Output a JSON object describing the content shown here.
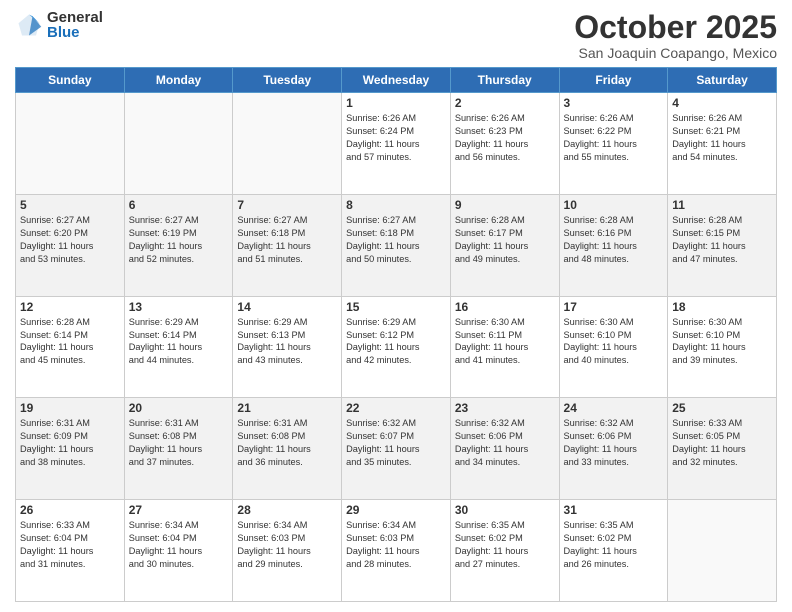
{
  "header": {
    "logo_general": "General",
    "logo_blue": "Blue",
    "month_title": "October 2025",
    "location": "San Joaquin Coapango, Mexico"
  },
  "days_of_week": [
    "Sunday",
    "Monday",
    "Tuesday",
    "Wednesday",
    "Thursday",
    "Friday",
    "Saturday"
  ],
  "weeks": [
    [
      {
        "day": "",
        "info": ""
      },
      {
        "day": "",
        "info": ""
      },
      {
        "day": "",
        "info": ""
      },
      {
        "day": "1",
        "info": "Sunrise: 6:26 AM\nSunset: 6:24 PM\nDaylight: 11 hours\nand 57 minutes."
      },
      {
        "day": "2",
        "info": "Sunrise: 6:26 AM\nSunset: 6:23 PM\nDaylight: 11 hours\nand 56 minutes."
      },
      {
        "day": "3",
        "info": "Sunrise: 6:26 AM\nSunset: 6:22 PM\nDaylight: 11 hours\nand 55 minutes."
      },
      {
        "day": "4",
        "info": "Sunrise: 6:26 AM\nSunset: 6:21 PM\nDaylight: 11 hours\nand 54 minutes."
      }
    ],
    [
      {
        "day": "5",
        "info": "Sunrise: 6:27 AM\nSunset: 6:20 PM\nDaylight: 11 hours\nand 53 minutes."
      },
      {
        "day": "6",
        "info": "Sunrise: 6:27 AM\nSunset: 6:19 PM\nDaylight: 11 hours\nand 52 minutes."
      },
      {
        "day": "7",
        "info": "Sunrise: 6:27 AM\nSunset: 6:18 PM\nDaylight: 11 hours\nand 51 minutes."
      },
      {
        "day": "8",
        "info": "Sunrise: 6:27 AM\nSunset: 6:18 PM\nDaylight: 11 hours\nand 50 minutes."
      },
      {
        "day": "9",
        "info": "Sunrise: 6:28 AM\nSunset: 6:17 PM\nDaylight: 11 hours\nand 49 minutes."
      },
      {
        "day": "10",
        "info": "Sunrise: 6:28 AM\nSunset: 6:16 PM\nDaylight: 11 hours\nand 48 minutes."
      },
      {
        "day": "11",
        "info": "Sunrise: 6:28 AM\nSunset: 6:15 PM\nDaylight: 11 hours\nand 47 minutes."
      }
    ],
    [
      {
        "day": "12",
        "info": "Sunrise: 6:28 AM\nSunset: 6:14 PM\nDaylight: 11 hours\nand 45 minutes."
      },
      {
        "day": "13",
        "info": "Sunrise: 6:29 AM\nSunset: 6:14 PM\nDaylight: 11 hours\nand 44 minutes."
      },
      {
        "day": "14",
        "info": "Sunrise: 6:29 AM\nSunset: 6:13 PM\nDaylight: 11 hours\nand 43 minutes."
      },
      {
        "day": "15",
        "info": "Sunrise: 6:29 AM\nSunset: 6:12 PM\nDaylight: 11 hours\nand 42 minutes."
      },
      {
        "day": "16",
        "info": "Sunrise: 6:30 AM\nSunset: 6:11 PM\nDaylight: 11 hours\nand 41 minutes."
      },
      {
        "day": "17",
        "info": "Sunrise: 6:30 AM\nSunset: 6:10 PM\nDaylight: 11 hours\nand 40 minutes."
      },
      {
        "day": "18",
        "info": "Sunrise: 6:30 AM\nSunset: 6:10 PM\nDaylight: 11 hours\nand 39 minutes."
      }
    ],
    [
      {
        "day": "19",
        "info": "Sunrise: 6:31 AM\nSunset: 6:09 PM\nDaylight: 11 hours\nand 38 minutes."
      },
      {
        "day": "20",
        "info": "Sunrise: 6:31 AM\nSunset: 6:08 PM\nDaylight: 11 hours\nand 37 minutes."
      },
      {
        "day": "21",
        "info": "Sunrise: 6:31 AM\nSunset: 6:08 PM\nDaylight: 11 hours\nand 36 minutes."
      },
      {
        "day": "22",
        "info": "Sunrise: 6:32 AM\nSunset: 6:07 PM\nDaylight: 11 hours\nand 35 minutes."
      },
      {
        "day": "23",
        "info": "Sunrise: 6:32 AM\nSunset: 6:06 PM\nDaylight: 11 hours\nand 34 minutes."
      },
      {
        "day": "24",
        "info": "Sunrise: 6:32 AM\nSunset: 6:06 PM\nDaylight: 11 hours\nand 33 minutes."
      },
      {
        "day": "25",
        "info": "Sunrise: 6:33 AM\nSunset: 6:05 PM\nDaylight: 11 hours\nand 32 minutes."
      }
    ],
    [
      {
        "day": "26",
        "info": "Sunrise: 6:33 AM\nSunset: 6:04 PM\nDaylight: 11 hours\nand 31 minutes."
      },
      {
        "day": "27",
        "info": "Sunrise: 6:34 AM\nSunset: 6:04 PM\nDaylight: 11 hours\nand 30 minutes."
      },
      {
        "day": "28",
        "info": "Sunrise: 6:34 AM\nSunset: 6:03 PM\nDaylight: 11 hours\nand 29 minutes."
      },
      {
        "day": "29",
        "info": "Sunrise: 6:34 AM\nSunset: 6:03 PM\nDaylight: 11 hours\nand 28 minutes."
      },
      {
        "day": "30",
        "info": "Sunrise: 6:35 AM\nSunset: 6:02 PM\nDaylight: 11 hours\nand 27 minutes."
      },
      {
        "day": "31",
        "info": "Sunrise: 6:35 AM\nSunset: 6:02 PM\nDaylight: 11 hours\nand 26 minutes."
      },
      {
        "day": "",
        "info": ""
      }
    ]
  ]
}
